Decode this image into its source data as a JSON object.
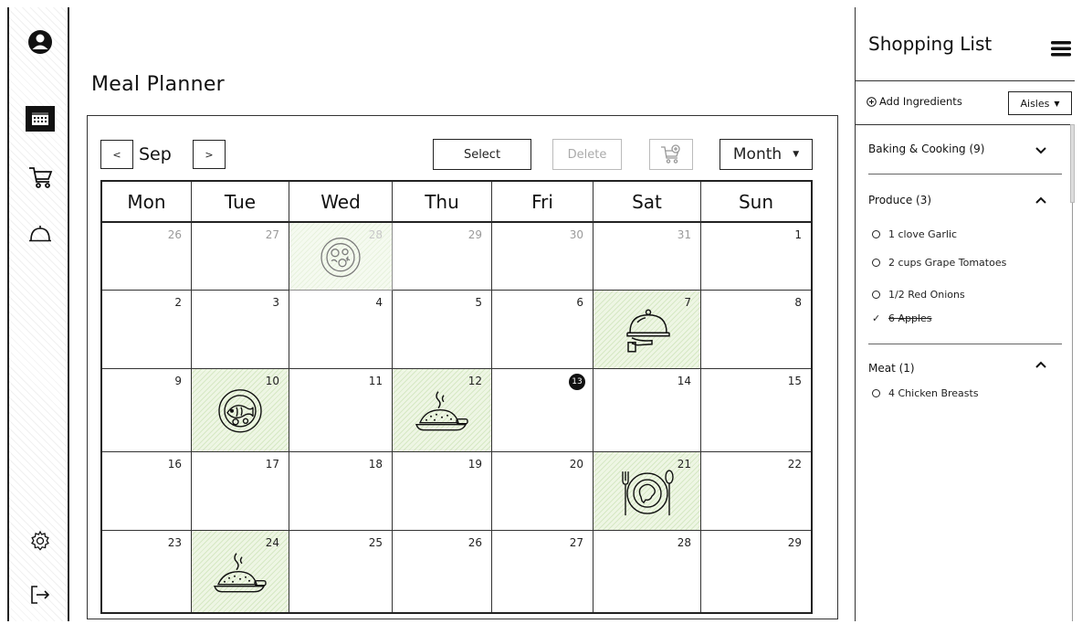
{
  "app": {
    "title": "Meal Planner"
  },
  "sidebar": {
    "items": [
      {
        "name": "profile",
        "icon": "user-circle-icon"
      },
      {
        "name": "calendar",
        "icon": "calendar-icon",
        "active": true
      },
      {
        "name": "cart",
        "icon": "shopping-cart-icon"
      },
      {
        "name": "meals",
        "icon": "cloche-icon"
      },
      {
        "name": "settings",
        "icon": "gear-icon"
      },
      {
        "name": "logout",
        "icon": "logout-icon"
      }
    ]
  },
  "toolbar": {
    "prev_label": "<",
    "month_label": "Sep",
    "next_label": ">",
    "select_label": "Select",
    "delete_label": "Delete",
    "view_label": "Month"
  },
  "calendar": {
    "days": [
      "Mon",
      "Tue",
      "Wed",
      "Thu",
      "Fri",
      "Sat",
      "Sun"
    ],
    "today": "13",
    "weeks": [
      [
        {
          "day": "26",
          "muted": true
        },
        {
          "day": "27",
          "muted": true
        },
        {
          "day": "28",
          "muted": true,
          "meal": "salad"
        },
        {
          "day": "29",
          "muted": true
        },
        {
          "day": "30",
          "muted": true
        },
        {
          "day": "31",
          "muted": true
        },
        {
          "day": "1"
        }
      ],
      [
        {
          "day": "2"
        },
        {
          "day": "3"
        },
        {
          "day": "4"
        },
        {
          "day": "5"
        },
        {
          "day": "6"
        },
        {
          "day": "7",
          "meal": "cloche"
        },
        {
          "day": "8"
        }
      ],
      [
        {
          "day": "9"
        },
        {
          "day": "10",
          "meal": "fish"
        },
        {
          "day": "11"
        },
        {
          "day": "12",
          "meal": "rice"
        },
        {
          "day": "13",
          "today": true
        },
        {
          "day": "14"
        },
        {
          "day": "15"
        }
      ],
      [
        {
          "day": "16"
        },
        {
          "day": "17"
        },
        {
          "day": "18"
        },
        {
          "day": "19"
        },
        {
          "day": "20"
        },
        {
          "day": "21",
          "meal": "plate"
        },
        {
          "day": "22"
        }
      ],
      [
        {
          "day": "23"
        },
        {
          "day": "24",
          "meal": "rice"
        },
        {
          "day": "25"
        },
        {
          "day": "26"
        },
        {
          "day": "27"
        },
        {
          "day": "28"
        },
        {
          "day": "29"
        }
      ]
    ]
  },
  "shopping": {
    "title": "Shopping List",
    "add_label": "Add Ingredients",
    "sort_label": "Aisles",
    "sections": [
      {
        "label": "Baking & Cooking (9)",
        "expanded": false,
        "items": []
      },
      {
        "label": "Produce (3)",
        "expanded": true,
        "items": [
          {
            "text": "1 clove Garlic",
            "done": false
          },
          {
            "text": "2 cups Grape Tomatoes",
            "done": false
          },
          {
            "text": "1/2 Red Onions",
            "done": false
          },
          {
            "text": "6 Apples",
            "done": true
          }
        ]
      },
      {
        "label": "Meat (1)",
        "expanded": true,
        "items": [
          {
            "text": "4 Chicken Breasts",
            "done": false
          }
        ]
      }
    ]
  },
  "colors": {
    "meal_fill": "#d6e8c4",
    "accent": "#222222",
    "muted_text": "#9a9a9a"
  }
}
